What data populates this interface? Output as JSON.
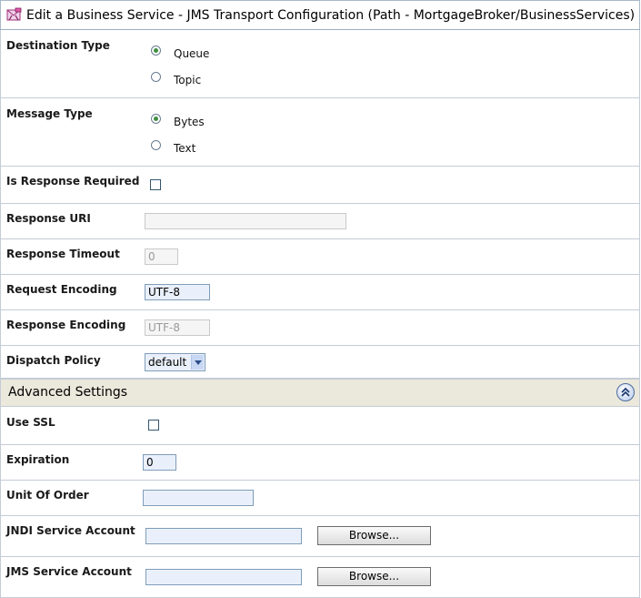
{
  "window": {
    "title": "Edit a Business Service - JMS Transport Configuration (Path - MortgageBroker/BusinessServices)"
  },
  "form": {
    "destination_type": {
      "label": "Destination Type",
      "options": [
        "Queue",
        "Topic"
      ],
      "selected": "Queue"
    },
    "message_type": {
      "label": "Message Type",
      "options": [
        "Bytes",
        "Text"
      ],
      "selected": "Bytes"
    },
    "is_response_required": {
      "label": "Is Response Required",
      "checked": false
    },
    "response_uri": {
      "label": "Response URI",
      "value": ""
    },
    "response_timeout": {
      "label": "Response Timeout",
      "value": "0"
    },
    "request_encoding": {
      "label": "Request Encoding",
      "value": "UTF-8"
    },
    "response_encoding": {
      "label": "Response Encoding",
      "value": "UTF-8"
    },
    "dispatch_policy": {
      "label": "Dispatch Policy",
      "value": "default"
    }
  },
  "advanced": {
    "title": "Advanced Settings",
    "use_ssl": {
      "label": "Use SSL",
      "checked": false
    },
    "expiration": {
      "label": "Expiration",
      "value": "0"
    },
    "unit_of_order": {
      "label": "Unit Of Order",
      "value": ""
    },
    "jndi_service_account": {
      "label": "JNDI Service Account",
      "value": "",
      "browse_label": "Browse..."
    },
    "jms_service_account": {
      "label": "JMS Service Account",
      "value": "",
      "browse_label": "Browse..."
    }
  },
  "colors": {
    "section_header_bg": "#ebe8dc",
    "input_bg": "#eaf0fb",
    "radio_checked": "#3f8f3f"
  }
}
